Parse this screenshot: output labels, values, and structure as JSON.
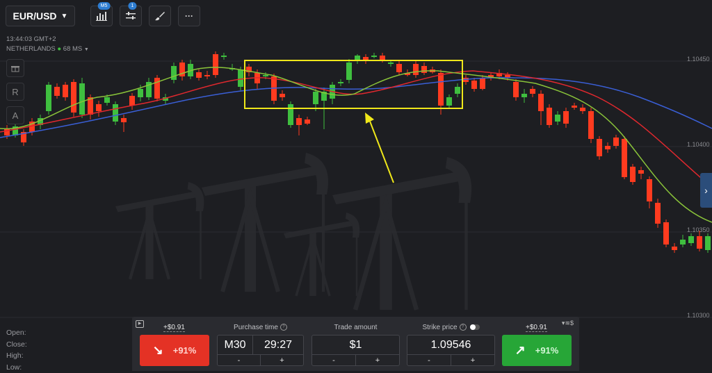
{
  "toolbar": {
    "pair": "EUR/USD",
    "chart_badge": "M5",
    "indicator_badge": "1",
    "more_icon": "···"
  },
  "info": {
    "time": "13:44:03 GMT+2",
    "server": "NETHERLANDS",
    "ping": "68 MS"
  },
  "side_tools": {
    "tool2": "R",
    "tool3": "A"
  },
  "ohlc": {
    "open": "Open:",
    "close": "Close:",
    "high": "High:",
    "low": "Low:"
  },
  "price_axis": [
    "1.10450",
    "1.10400",
    "1.10350",
    "1.10300"
  ],
  "panel": {
    "put": {
      "payout": "+$0.91",
      "percent": "+91%"
    },
    "call": {
      "payout": "+$0.91",
      "percent": "+91%"
    },
    "purchase_time": {
      "label": "Purchase time",
      "timeframe": "M30",
      "value": "29:27",
      "minus": "-",
      "plus": "+"
    },
    "trade_amount": {
      "label": "Trade amount",
      "value": "$1",
      "minus": "-",
      "plus": "+"
    },
    "strike_price": {
      "label": "Strike price",
      "value": "1.09546",
      "minus": "-",
      "plus": "+"
    },
    "currency_switch": "$"
  },
  "colors": {
    "bull": "#3fbf3f",
    "bear": "#ff3b1f",
    "ma_fast": "#8ac43a",
    "ma_mid": "#e0282e",
    "ma_slow": "#3a5fd6",
    "highlight": "#f0e81a"
  }
}
